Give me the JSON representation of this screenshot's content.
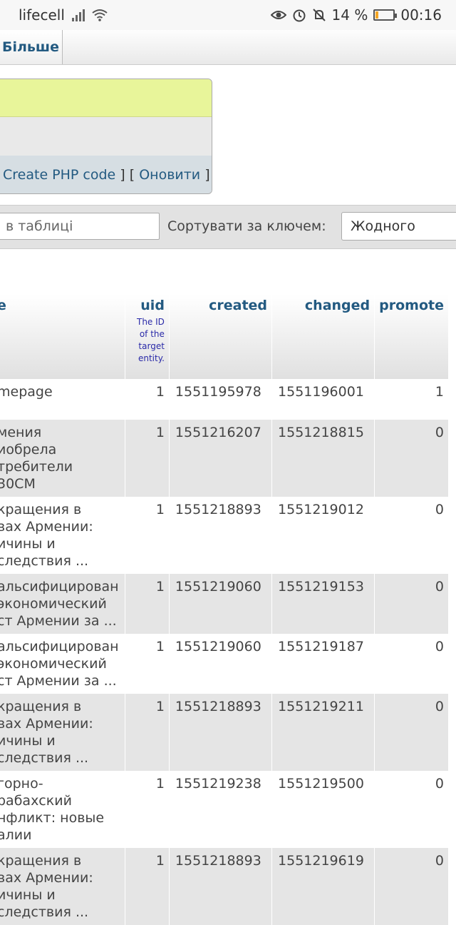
{
  "status_bar": {
    "carrier": "lifecell",
    "battery": "14 %",
    "battery_level": 0.14,
    "time": "00:16",
    "icons": [
      "signal-icon",
      "wifi-icon",
      "eye-icon",
      "alarm-icon",
      "bell-off-icon",
      "battery-icon"
    ]
  },
  "tabs": {
    "more_label": "Більше"
  },
  "query_box": {
    "create_php": "Create PHP code",
    "refresh": "Оновити"
  },
  "filter": {
    "search_placeholder": "в таблиці",
    "sort_label": "Сортувати за ключем:",
    "sort_value": "Жодного"
  },
  "table": {
    "columns": [
      {
        "label": "e",
        "comment": ""
      },
      {
        "label": "uid",
        "comment": "The ID of the target entity."
      },
      {
        "label": "created",
        "comment": ""
      },
      {
        "label": "changed",
        "comment": ""
      },
      {
        "label": "promote",
        "comment": ""
      }
    ],
    "rows": [
      {
        "title": "mepage",
        "uid": "1",
        "created": "1551195978",
        "changed": "1551196001",
        "promote": "1"
      },
      {
        "title": "мения\nиобрела\nтребители\n30CM",
        "uid": "1",
        "created": "1551216207",
        "changed": "1551218815",
        "promote": "0"
      },
      {
        "title": "кращения в\nвах Армении:\nичины и\nследствия ...",
        "uid": "1",
        "created": "1551218893",
        "changed": "1551219012",
        "promote": "0"
      },
      {
        "title": "альсифицирован\nэкономический\nст Армении за ...",
        "uid": "1",
        "created": "1551219060",
        "changed": "1551219153",
        "promote": "0"
      },
      {
        "title": "альсифицирован\nэкономический\nст Армении за ...",
        "uid": "1",
        "created": "1551219060",
        "changed": "1551219187",
        "promote": "0"
      },
      {
        "title": "кращения в\nвах Армении:\nичины и\nследствия ...",
        "uid": "1",
        "created": "1551218893",
        "changed": "1551219211",
        "promote": "0"
      },
      {
        "title": "горно-\nрабахский\nнфликт: новые\nалии",
        "uid": "1",
        "created": "1551219238",
        "changed": "1551219500",
        "promote": "0"
      },
      {
        "title": "кращения в\nвах Армении:\nичины и\nследствия ...",
        "uid": "1",
        "created": "1551218893",
        "changed": "1551219619",
        "promote": "0"
      }
    ]
  }
}
